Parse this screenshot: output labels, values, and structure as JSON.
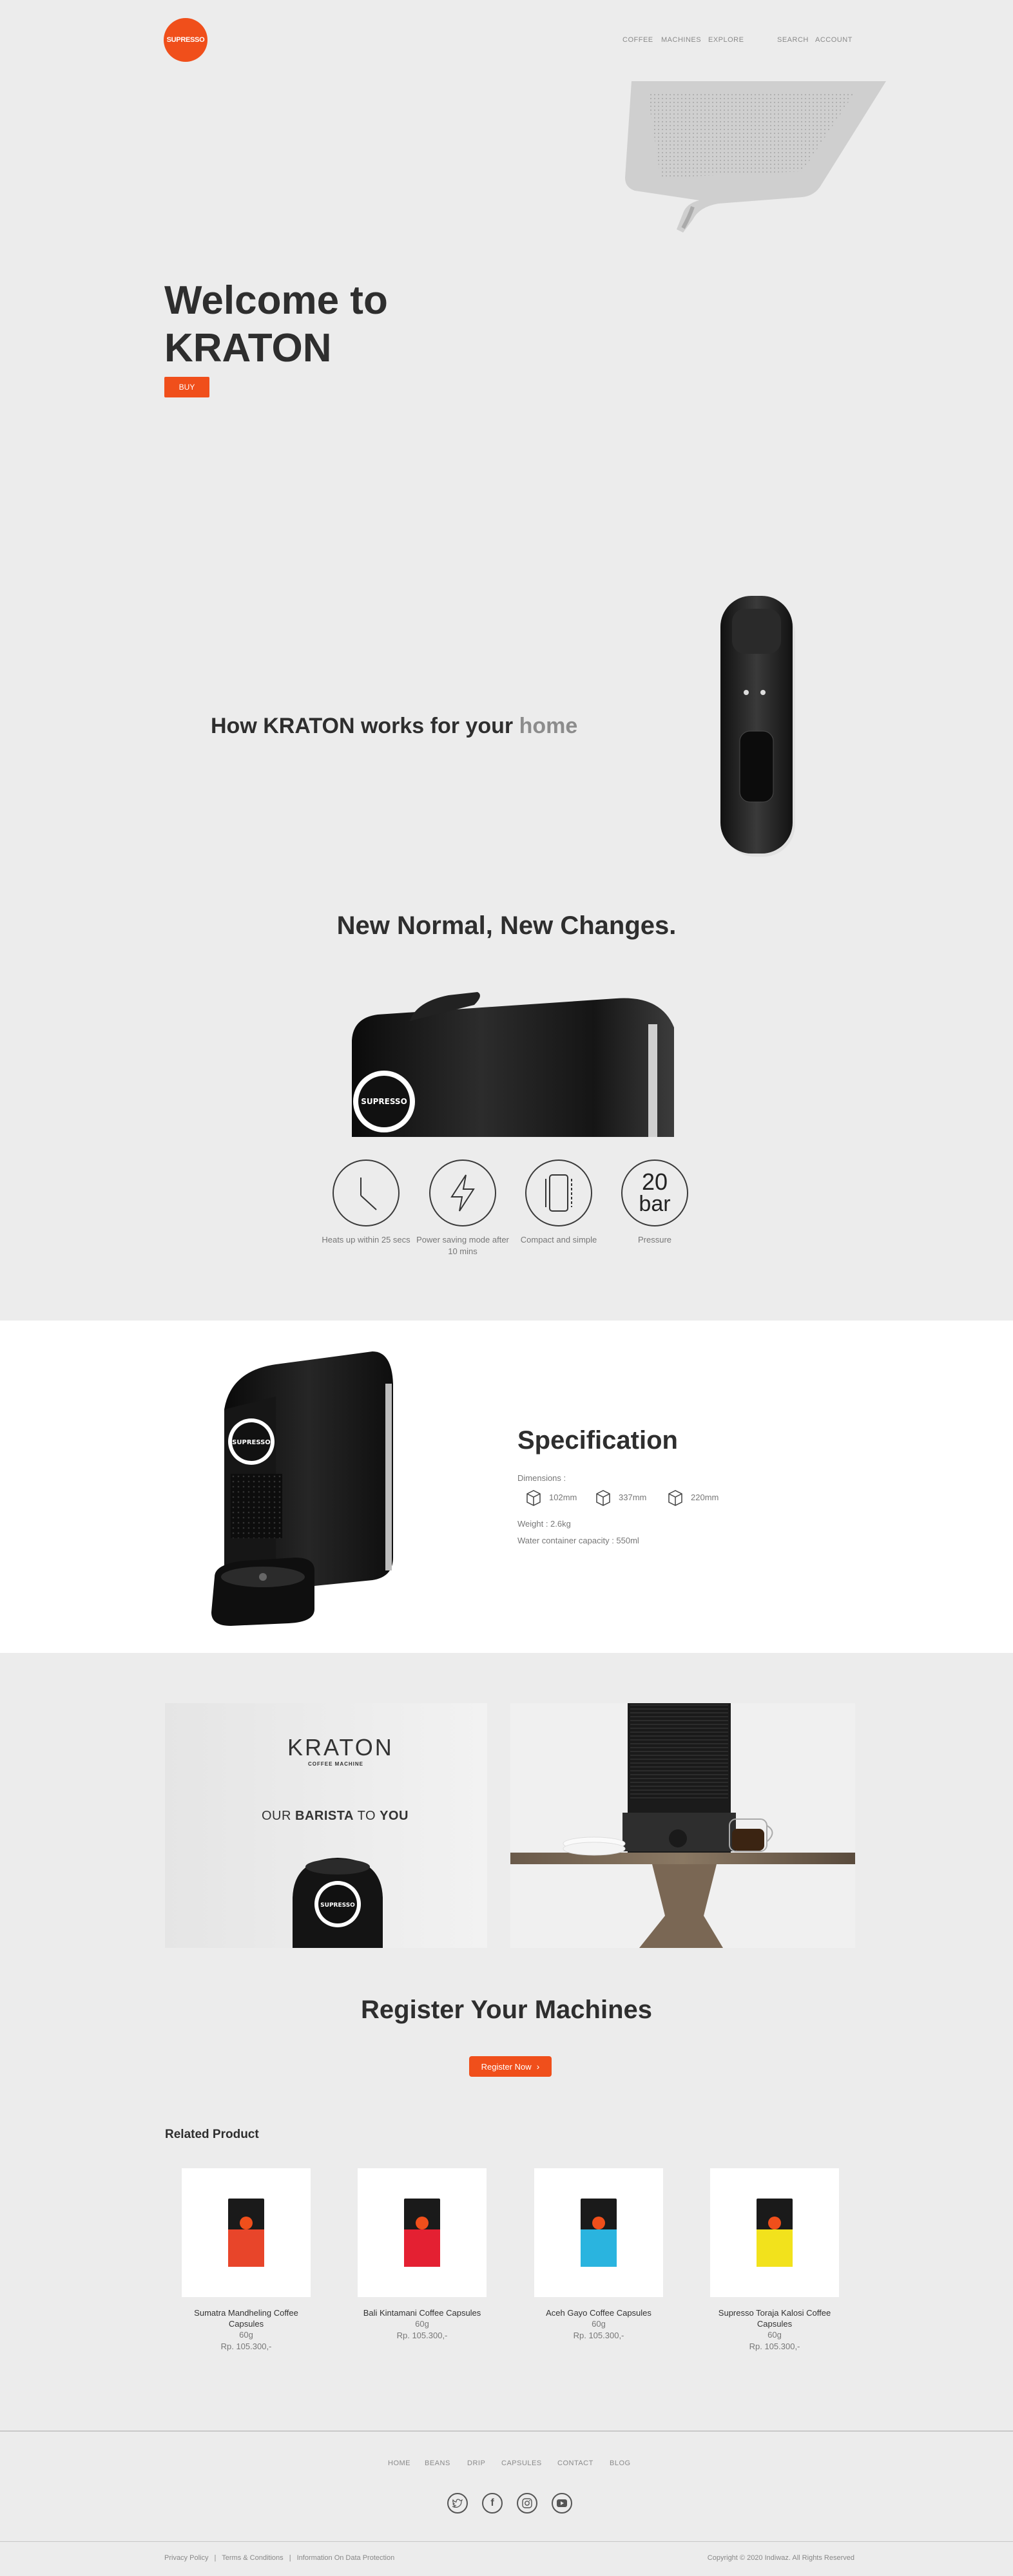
{
  "brand": {
    "logo_text": "SUPRESSO",
    "accent_color": "#f04f1b"
  },
  "nav": {
    "coffee": "COFFEE",
    "machines": "MACHINES",
    "explore": "EXPLORE",
    "search": "SEARCH",
    "account": "ACCOUNT"
  },
  "hero": {
    "line1": "Welcome to",
    "line2": "KRATON",
    "buy_label": "BUY"
  },
  "how": {
    "text": "How KRATON works for your ",
    "accent": "home"
  },
  "new_normal": {
    "title": "New Normal, New Changes."
  },
  "features": [
    {
      "icon": "clock-icon",
      "caption": "Heats up within 25 secs"
    },
    {
      "icon": "lightning-icon",
      "caption": "Power saving mode after 10 mins"
    },
    {
      "icon": "compact-icon",
      "caption": "Compact and simple"
    },
    {
      "icon": "pressure-icon",
      "big": "20",
      "unit": "bar",
      "caption": "Pressure"
    }
  ],
  "spec": {
    "title": "Specification",
    "dimensions_label": "Dimensions :",
    "dims": [
      "102mm",
      "337mm",
      "220mm"
    ],
    "weight": "Weight : 2.6kg",
    "water": "Water container capacity : 550ml"
  },
  "promo": {
    "brand": "KRATON",
    "tagline": "COFFEE MACHINE",
    "our": "OUR ",
    "barista": "BARISTA",
    "to": " TO ",
    "you": "YOU",
    "machine_logo": "SUPRESSO"
  },
  "register": {
    "title": "Register Your Machines",
    "button": "Register Now"
  },
  "related": {
    "title": "Related Product",
    "products": [
      {
        "name": "Sumatra Mandheling Coffee Capsules",
        "weight": "60g",
        "price": "Rp. 105.300,-",
        "color": "#e8452a"
      },
      {
        "name": "Bali Kintamani Coffee Capsules",
        "weight": "60g",
        "price": "Rp. 105.300,-",
        "color": "#e42032"
      },
      {
        "name": "Aceh Gayo Coffee Capsules",
        "weight": "60g",
        "price": "Rp. 105.300,-",
        "color": "#2ab4df"
      },
      {
        "name": "Supresso Toraja Kalosi Coffee Capsules",
        "weight": "60g",
        "price": "Rp. 105.300,-",
        "color": "#f2e21c"
      }
    ]
  },
  "footer": {
    "nav": [
      "HOME",
      "BEANS",
      "DRIP",
      "CAPSULES",
      "CONTACT",
      "BLOG"
    ],
    "social": [
      "twitter-icon",
      "facebook-icon",
      "instagram-icon",
      "youtube-icon"
    ],
    "privacy": "Privacy Policy",
    "terms": "Terms & Conditions",
    "data": "Information On Data Protection",
    "copyright": "Copyright © 2020 Indiwaz. All Rights Reserved"
  }
}
